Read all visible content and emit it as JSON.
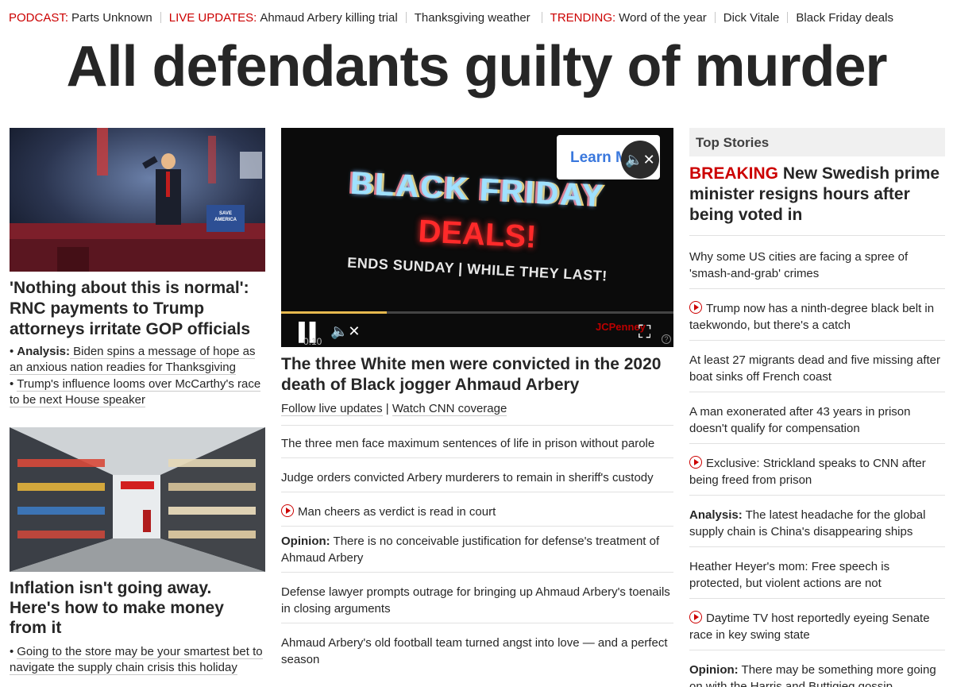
{
  "topbar": [
    {
      "label": "PODCAST:",
      "text": "Parts Unknown"
    },
    {
      "label": "LIVE UPDATES:",
      "text": "Ahmaud Arbery killing trial"
    },
    {
      "label": "",
      "text": "Thanksgiving weather"
    },
    {
      "label": "TRENDING:",
      "text": "Word of the year"
    },
    {
      "label": "",
      "text": "Dick Vitale"
    },
    {
      "label": "",
      "text": "Black Friday deals"
    }
  ],
  "headline": "All defendants guilty of murder",
  "col1": {
    "story1_title": "'Nothing about this is normal': RNC payments to Trump attorneys irritate GOP officials",
    "story1_sub1_label": "Analysis:",
    "story1_sub1_text": " Biden spins a message of hope as an anxious nation readies for Thanksgiving",
    "story1_sub2_text": "Trump's influence looms over McCarthy's race to be next House speaker",
    "story1_img_banner": "SAVE AMERICA",
    "story2_title": "Inflation isn't going away. Here's how to make money from it",
    "story2_sub1_text": "Going to the store may be your smartest bet to navigate the supply chain crisis this holiday"
  },
  "video": {
    "learn_more": "Learn More",
    "line1": "BLACK FRIDAY",
    "line2": "DEALS!",
    "line3": "ENDS SUNDAY | WHILE THEY LAST!",
    "time": "0:10",
    "brand": "JCPenney",
    "progress_fraction": 0.27,
    "help": "?"
  },
  "col2": {
    "title": "The three White men were convicted in the 2020 death of Black jogger Ahmaud Arbery",
    "link1": "Follow live updates",
    "link_sep": " | ",
    "link2": "Watch CNN coverage",
    "items": [
      {
        "text": "The three men face maximum sentences of life in prison without parole"
      },
      {
        "text": "Judge orders convicted Arbery murderers to remain in sheriff's custody"
      },
      {
        "text": "Man cheers as verdict is read in court"
      },
      {
        "label": "Opinion:",
        "text": " There is no conceivable justification for defense's treatment of Ahmaud Arbery"
      },
      {
        "text": "Defense lawyer prompts outrage for bringing up Ahmaud Arbery's toenails in closing arguments"
      },
      {
        "text": "Ahmaud Arbery's old football team turned angst into love — and a perfect season"
      }
    ]
  },
  "col3": {
    "header": "Top Stories",
    "breaking_label": "BREAKING",
    "breaking_text": " New Swedish prime minister resigns hours after being voted in",
    "items": [
      {
        "text": "Why some US cities are facing a spree of 'smash-and-grab' crimes"
      },
      {
        "text": "Trump now has a ninth-degree black belt in taekwondo, but there's a catch"
      },
      {
        "text": "At least 27 migrants dead and five missing after boat sinks off French coast"
      },
      {
        "text": "A man exonerated after 43 years in prison doesn't qualify for compensation"
      },
      {
        "text": "Exclusive: Strickland speaks to CNN after being freed from prison"
      },
      {
        "label": "Analysis:",
        "text": " The latest headache for the global supply chain is China's disappearing ships"
      },
      {
        "text": "Heather Heyer's mom: Free speech is protected, but violent actions are not"
      },
      {
        "text": "Daytime TV host reportedly eyeing Senate race in key swing state"
      },
      {
        "label": "Opinion:",
        "text": " There may be something more going on with the Harris and Buttigieg gossip"
      }
    ]
  },
  "colors": {
    "accent": "#cc0000",
    "text": "#262626",
    "divider": "#e1e1e1"
  }
}
